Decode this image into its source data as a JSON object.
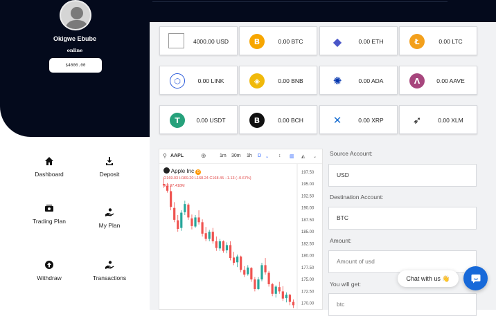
{
  "user": {
    "name": "Okigwe Ebube",
    "status": "online",
    "balance": "$4000.00"
  },
  "wallet_cards": [
    {
      "icon": "usd-flag-icon",
      "value": "4000.00 USD",
      "color": "#ffffff"
    },
    {
      "icon": "btc-icon",
      "value": "0.00 BTC",
      "color": "#f7a600"
    },
    {
      "icon": "eth-icon",
      "value": "0.00 ETH",
      "color": "#4a56c8"
    },
    {
      "icon": "ltc-icon",
      "value": "0.00 LTC",
      "color": "#f3a01c"
    },
    {
      "icon": "link-icon",
      "value": "0.00 LINK",
      "color": "#2a5ada"
    },
    {
      "icon": "bnb-icon",
      "value": "0.00 BNB",
      "color": "#f0b90b"
    },
    {
      "icon": "ada-icon",
      "value": "0.00 ADA",
      "color": "#0033ad"
    },
    {
      "icon": "aave-icon",
      "value": "0.00 AAVE",
      "color": "#a7467d"
    },
    {
      "icon": "usdt-icon",
      "value": "0.00 USDT",
      "color": "#26a17b"
    },
    {
      "icon": "bch-icon",
      "value": "0.00 BCH",
      "color": "#111111"
    },
    {
      "icon": "xrp-icon",
      "value": "0.00 XRP",
      "color": "#1a6fd1"
    },
    {
      "icon": "xlm-icon",
      "value": "0.00 XLM",
      "color": "#111111"
    }
  ],
  "nav": [
    {
      "label": "Dashboard",
      "icon": "home-icon"
    },
    {
      "label": "Deposit",
      "icon": "download-icon"
    },
    {
      "label": "Trading Plan",
      "icon": "money-icon"
    },
    {
      "label": "My Plan",
      "icon": "hand-coin-icon"
    },
    {
      "label": "Withdraw",
      "icon": "arrow-up-circle-icon"
    },
    {
      "label": "Transactions",
      "icon": "hand-coin-icon"
    }
  ],
  "chart_widget": {
    "symbol": "AAPL",
    "timeframes": [
      "1m",
      "30m",
      "1h",
      "D"
    ],
    "active_timeframe": "D",
    "instrument": "Apple Inc",
    "ohlc": "O169.03 H169.20 L168.24 C168.45 −1.13 (−0.67%)",
    "volume": "Vol 37.418M",
    "price_ticks": [
      "197.50",
      "195.00",
      "192.50",
      "190.00",
      "187.50",
      "185.00",
      "182.50",
      "180.00",
      "177.50",
      "175.00",
      "172.50",
      "170.00"
    ],
    "up_color": "#26a69a",
    "down_color": "#ef5350"
  },
  "chart_data": {
    "type": "candlestick",
    "ylim": [
      168.5,
      198.5
    ],
    "y_ticks": [
      197.5,
      195,
      192.5,
      190,
      187.5,
      185,
      182.5,
      180,
      177.5,
      175,
      172.5,
      170
    ],
    "candles": [
      [
        195,
        196.2,
        194.2,
        194.7
      ],
      [
        194.6,
        195.2,
        193.2,
        193.6
      ],
      [
        193.5,
        194.8,
        189.5,
        190.2
      ],
      [
        190,
        191.2,
        187,
        187.5
      ],
      [
        187.4,
        188.5,
        185,
        185.6
      ],
      [
        185.8,
        189.5,
        185.2,
        189
      ],
      [
        189.1,
        191.5,
        188.5,
        190.8
      ],
      [
        190.7,
        191,
        187.5,
        188
      ],
      [
        187.8,
        188.6,
        185.5,
        186.2
      ],
      [
        186.1,
        188.5,
        185.8,
        188
      ],
      [
        188,
        189.5,
        186.5,
        187
      ],
      [
        187,
        187.6,
        184,
        184.6
      ],
      [
        184.7,
        186,
        183,
        183.5
      ],
      [
        183.5,
        185.4,
        183,
        185
      ],
      [
        185,
        185.8,
        182.5,
        183
      ],
      [
        183,
        184,
        181,
        181.6
      ],
      [
        181.5,
        183.5,
        181,
        183
      ],
      [
        183,
        183.2,
        180.6,
        181
      ],
      [
        181.1,
        182.8,
        180.5,
        182.2
      ],
      [
        182.2,
        183,
        179,
        179.5
      ],
      [
        179.6,
        180.8,
        178,
        178.5
      ],
      [
        178.6,
        180.2,
        177.6,
        179.8
      ],
      [
        179.8,
        180,
        176.5,
        177
      ],
      [
        177,
        177.8,
        175.5,
        176
      ],
      [
        176.1,
        178,
        175.8,
        177.5
      ],
      [
        177.4,
        177.6,
        174.5,
        175
      ],
      [
        175,
        175.5,
        172.5,
        173
      ],
      [
        173,
        175.5,
        172.8,
        175
      ],
      [
        175,
        178.5,
        174.6,
        178
      ],
      [
        178,
        179.5,
        176,
        176.5
      ],
      [
        176.4,
        176.8,
        173.5,
        174
      ],
      [
        174,
        174.3,
        171.5,
        172
      ],
      [
        172,
        173.8,
        171.2,
        173.5
      ],
      [
        173.4,
        174.5,
        172,
        172.5
      ],
      [
        172.5,
        173.6,
        170.5,
        171
      ],
      [
        171.1,
        172.3,
        170.2,
        171.8
      ],
      [
        171.8,
        172,
        169.6,
        170.3
      ],
      [
        170.3,
        170.8,
        169,
        169.6
      ]
    ]
  },
  "exchange_form": {
    "source_label": "Source Account:",
    "source_value": "USD",
    "dest_label": "Destination Account:",
    "dest_value": "BTC",
    "amount_label": "Amount:",
    "amount_placeholder": "Amount of usd",
    "get_label": "You will get:",
    "get_placeholder": "btc"
  },
  "chat": {
    "label": "Chat with us 👋"
  }
}
